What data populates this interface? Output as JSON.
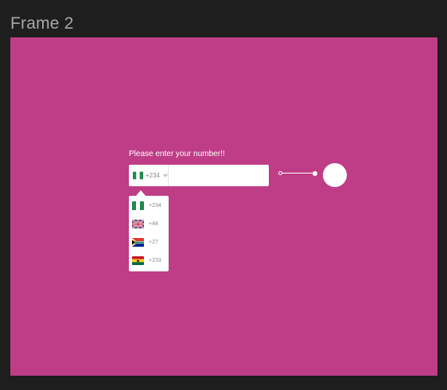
{
  "frame": {
    "title": "Frame 2",
    "background": "#bf3d87"
  },
  "form": {
    "prompt": "Please enter your number!!",
    "selected_code": "+234",
    "selected_flag": "nigeria-flag-icon",
    "number_value": "",
    "number_placeholder": ""
  },
  "dropdown": {
    "options": [
      {
        "code": "+234",
        "flag": "nigeria-flag-icon"
      },
      {
        "code": "+44",
        "flag": "uk-flag-icon"
      },
      {
        "code": "+27",
        "flag": "south-africa-flag-icon"
      },
      {
        "code": "+233",
        "flag": "ghana-flag-icon"
      }
    ]
  },
  "slider": {
    "progress": 1.0
  }
}
